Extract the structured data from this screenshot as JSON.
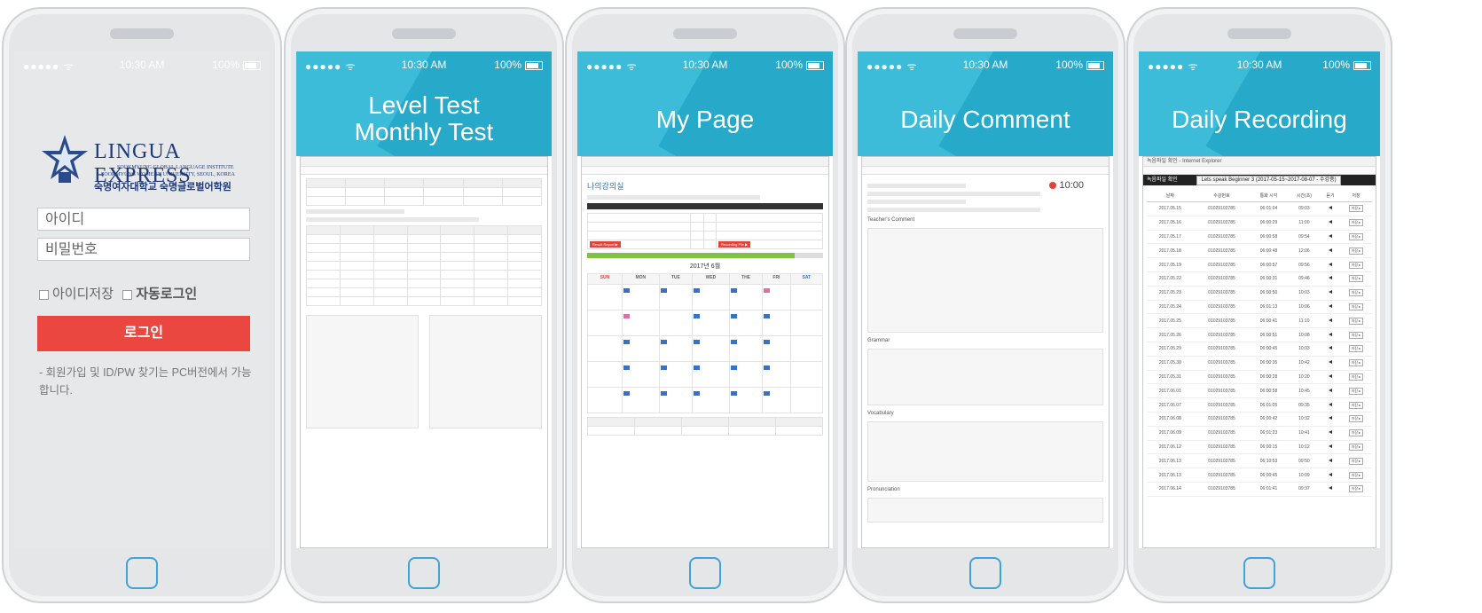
{
  "phone1": {
    "status": {
      "signal": "●●●●● ᯤ",
      "time": "10:30 AM",
      "battery": "100%"
    },
    "logo": {
      "name": "LINGUA EXPRESS",
      "line1": "SOOKMYUNG GLOBAL LANGUAGE INSTITUTE",
      "line2": "SOOKMYUNG WOMEN'S UNIVERSITY, SEOUL, KOREA",
      "korean": "숙명여자대학교 숙명글로벌어학원"
    },
    "id_placeholder": "아이디",
    "pw_placeholder": "비밀번호",
    "save_id": "아이디저장",
    "auto_login": "자동로그인",
    "login_button": "로그인",
    "note": "- 회원가입 및 ID/PW 찾기는 PC버전에서 가능합니다."
  },
  "phone2": {
    "status": {
      "signal": "●●●●● ᯤ",
      "time": "10:30 AM",
      "battery": "100%"
    },
    "title_line1": "Level Test",
    "title_line2": "Monthly Test"
  },
  "phone3": {
    "status": {
      "signal": "●●●●● ᯤ",
      "time": "10:30 AM",
      "battery": "100%"
    },
    "title": "My Page",
    "page_heading": "나의강의실",
    "month": "2017년 6월",
    "weekdays": [
      "SUN",
      "MON",
      "TUE",
      "WED",
      "THE",
      "FRI",
      "SAT"
    ],
    "report_button": "Result Report ▶",
    "recording_button": "Recording File ▶",
    "progress_percent": 88
  },
  "phone4": {
    "status": {
      "signal": "●●●●● ᯤ",
      "time": "10:30 AM",
      "battery": "100%"
    },
    "title": "Daily Comment",
    "timer": "10:00",
    "sections": [
      "Teacher's Comment",
      "Grammar",
      "Vocabulary",
      "Pronunciation"
    ]
  },
  "phone5": {
    "status": {
      "signal": "●●●●● ᯤ",
      "time": "10:30 AM",
      "battery": "100%"
    },
    "title": "Daily Recording",
    "window_title": "녹음파일 확인 - Internet Explorer",
    "toolbar_label": "녹음파일 확인",
    "select_value": "Lets speak Beginner 3 (2017-05-15~2017-08-07 - 수강중)",
    "columns": [
      "날짜",
      "수강번호",
      "통화 시각",
      "시간(초)",
      "듣기",
      "저장"
    ],
    "rows": [
      [
        "2017.05.15",
        "01029103785",
        "06:01:04",
        "09:03"
      ],
      [
        "2017.05.16",
        "01029103785",
        "06:00:29",
        "11:00"
      ],
      [
        "2017.05.17",
        "01029103785",
        "06:00:58",
        "09:54"
      ],
      [
        "2017.05.18",
        "01029103785",
        "06:00:48",
        "12:06"
      ],
      [
        "2017.05.19",
        "01029103785",
        "06:00:57",
        "09:56"
      ],
      [
        "2017.05.22",
        "01029103785",
        "06:00:31",
        "09:46"
      ],
      [
        "2017.05.23",
        "01029103785",
        "06:00:50",
        "10:03"
      ],
      [
        "2017.05.24",
        "01029103785",
        "06:01:13",
        "10:06"
      ],
      [
        "2017.05.25",
        "01029103785",
        "06:00:41",
        "11:10"
      ],
      [
        "2017.05.26",
        "01029103785",
        "06:00:51",
        "10:08"
      ],
      [
        "2017.05.29",
        "01029103785",
        "06:00:45",
        "10:03"
      ],
      [
        "2017.05.30",
        "01029103785",
        "06:00:35",
        "10:42"
      ],
      [
        "2017.05.31",
        "01029103785",
        "06:00:28",
        "10:20"
      ],
      [
        "2017.06.01",
        "01029103785",
        "06:00:58",
        "10:45"
      ],
      [
        "2017.06.07",
        "01029103785",
        "06:01:05",
        "09:35"
      ],
      [
        "2017.06.08",
        "01029103785",
        "06:00:42",
        "10:32"
      ],
      [
        "2017.06.09",
        "01029103785",
        "06:01:23",
        "10:41"
      ],
      [
        "2017.06.12",
        "01029103785",
        "06:00:15",
        "10:12"
      ],
      [
        "2017.06.13",
        "01029103785",
        "06:10:53",
        "09:50"
      ],
      [
        "2017.06.13",
        "01029103785",
        "06:00:45",
        "10:09"
      ],
      [
        "2017.06.14",
        "01029103785",
        "06:01:41",
        "09:37"
      ]
    ],
    "save_label": "저장 ▸"
  }
}
